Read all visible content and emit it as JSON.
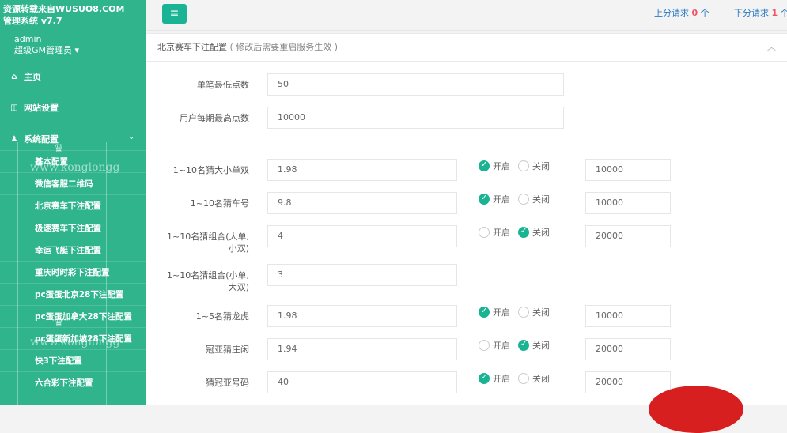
{
  "sidebar": {
    "brand_line1": "资源转载来自WUSUO8.COM",
    "brand_line2": "管理系统 v7.7",
    "user": "admin",
    "role": "超级GM管理员",
    "nav": [
      {
        "label": "主页",
        "icon": "home-icon"
      },
      {
        "label": "网站设置",
        "icon": "columns-icon"
      },
      {
        "label": "系统配置",
        "icon": "user-icon"
      }
    ],
    "sub_items": [
      {
        "label": "基本配置"
      },
      {
        "label": "微信客服二维码"
      },
      {
        "label": "北京赛车下注配置"
      },
      {
        "label": "极速赛车下注配置"
      },
      {
        "label": "幸运飞艇下注配置"
      },
      {
        "label": "重庆时时彩下注配置"
      },
      {
        "label": "pc蛋蛋北京28下注配置"
      },
      {
        "label": "pc蛋蛋加拿大28下注配置"
      },
      {
        "label": "pc蛋蛋新加坡28下注配置"
      },
      {
        "label": "快3下注配置"
      },
      {
        "label": "六合彩下注配置"
      }
    ],
    "watermark": "www.konglongg"
  },
  "topbar": {
    "up_label": "上分请求",
    "up_count": "0",
    "up_unit": "个",
    "down_label": "下分请求",
    "down_count": "1",
    "down_unit": "个"
  },
  "panel": {
    "title": "北京赛车下注配置",
    "note": "( 修改后需要重启服务生效 )"
  },
  "general": [
    {
      "label": "单笔最低点数",
      "value": "50"
    },
    {
      "label": "用户每期最高点数",
      "value": "10000"
    }
  ],
  "radio_labels": {
    "on": "开启",
    "off": "关闭"
  },
  "odds": [
    {
      "label": "1~10名猜大小单双",
      "value": "1.98",
      "enabled": true,
      "limit": "10000"
    },
    {
      "label": "1~10名猜车号",
      "value": "9.8",
      "enabled": true,
      "limit": "10000"
    },
    {
      "label": "1~10名猜组合(大单,",
      "label2": "小双)",
      "value": "4",
      "enabled": false,
      "limit": "20000"
    },
    {
      "label": "1~10名猜组合(小单,",
      "label2": "大双)",
      "value": "3"
    },
    {
      "label": "1~5名猜龙虎",
      "value": "1.98",
      "enabled": true,
      "limit": "10000"
    },
    {
      "label": "冠亚猜庄闲",
      "value": "1.94",
      "enabled": false,
      "limit": "20000"
    },
    {
      "label": "猜冠亚号码",
      "value": "40",
      "enabled": true,
      "limit": "20000"
    }
  ]
}
